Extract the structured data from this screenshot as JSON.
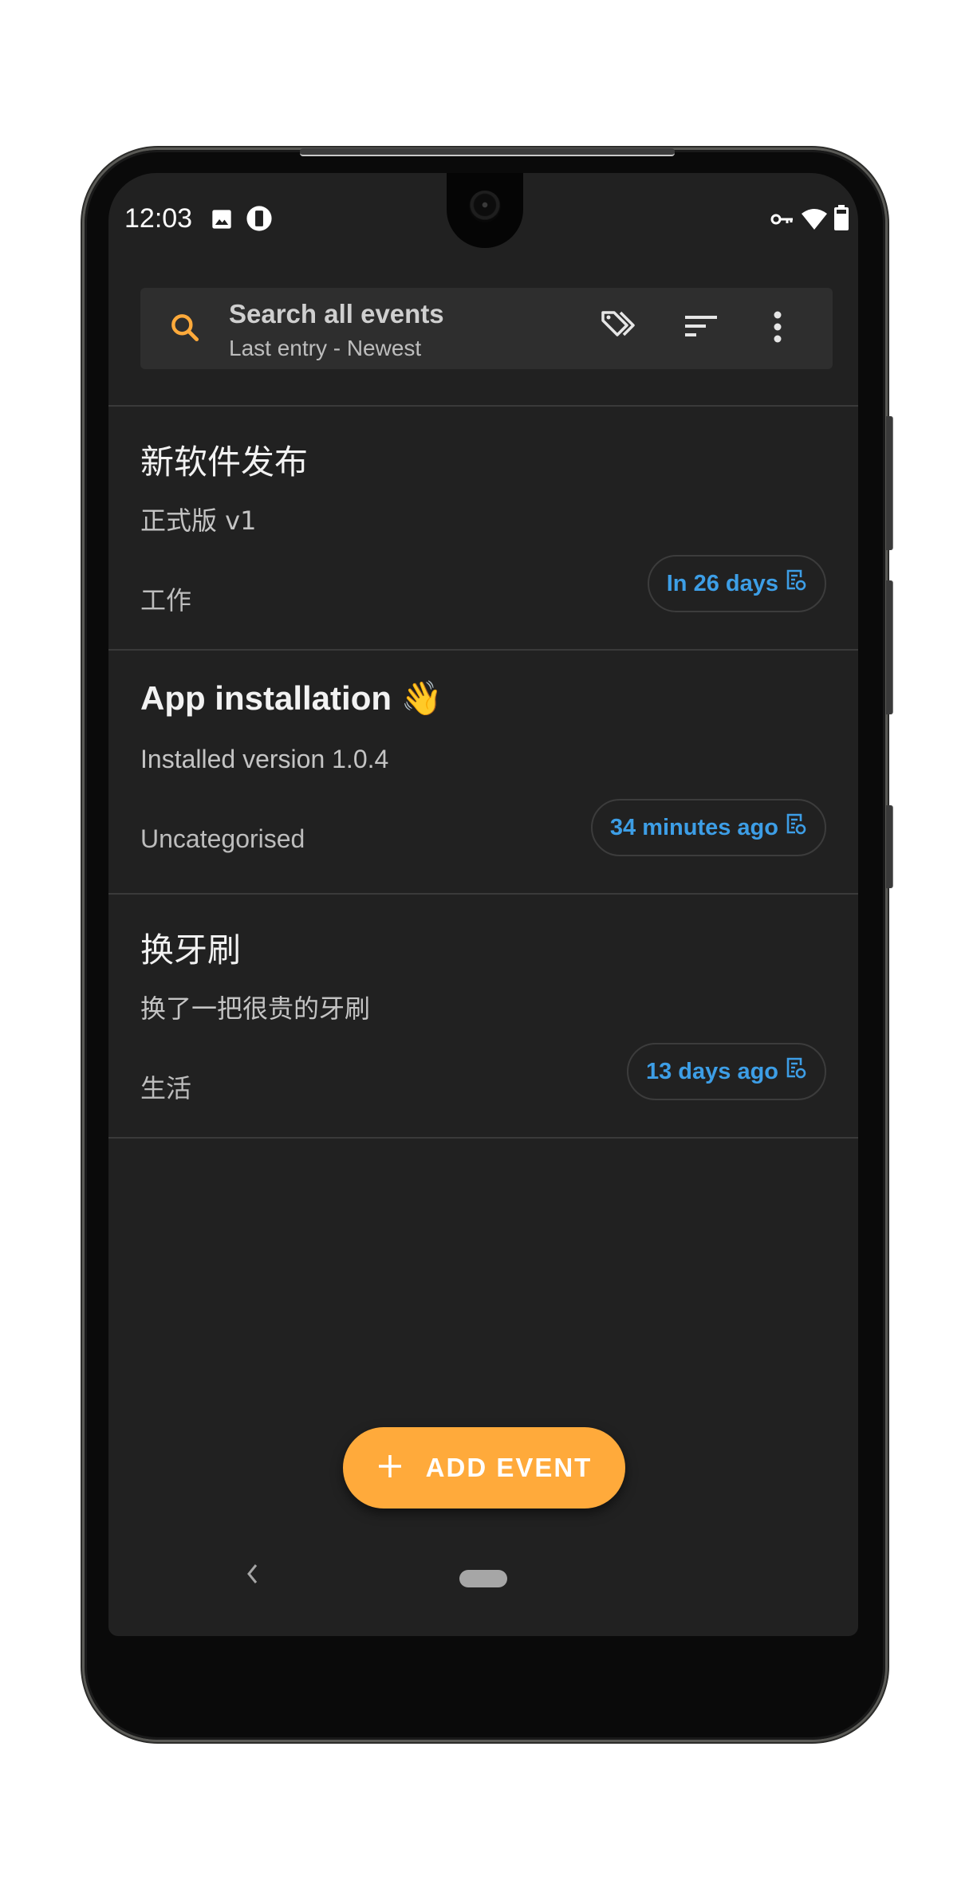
{
  "status_bar": {
    "time": "12:03",
    "left_icons": [
      "image-icon",
      "screen-record-icon"
    ],
    "right_icons": [
      "vpn-key-icon",
      "wifi-icon",
      "battery-icon"
    ]
  },
  "search": {
    "placeholder": "Search all events",
    "sort_label": "Last entry - Newest",
    "actions": [
      "tags-icon",
      "sort-icon",
      "more-vert-icon"
    ]
  },
  "events": [
    {
      "title": "新软件发布",
      "description": "正式版 v1",
      "category": "工作",
      "time_label": "In 26 days"
    },
    {
      "title": "App installation 👋",
      "description": "Installed version 1.0.4",
      "category": "Uncategorised",
      "time_label": "34 minutes ago"
    },
    {
      "title": "换牙刷",
      "description": "换了一把很贵的牙刷",
      "category": "生活",
      "time_label": "13 days ago"
    }
  ],
  "fab": {
    "label": "ADD EVENT",
    "icon": "plus-icon"
  },
  "colors": {
    "accent": "#ffaa3b",
    "badge_text": "#3d9ee6",
    "background": "#212121",
    "search_bar": "#2e2e2e"
  }
}
